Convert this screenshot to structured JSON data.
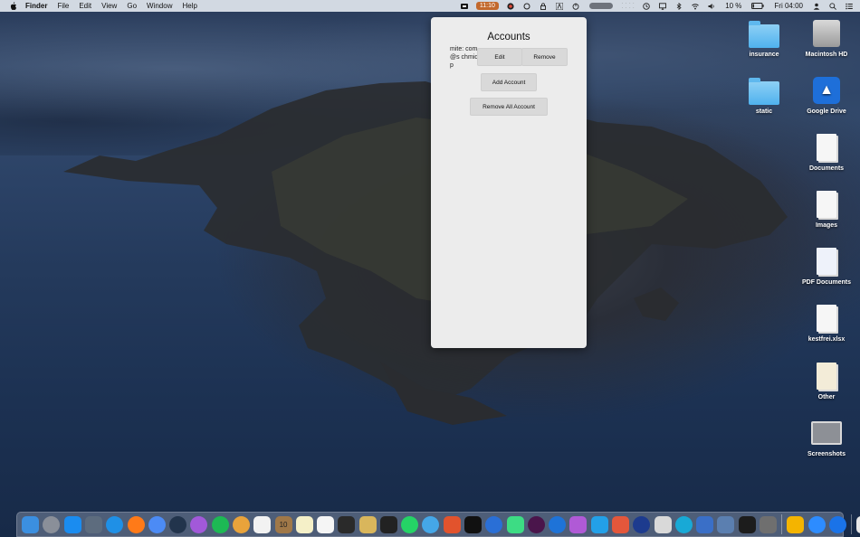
{
  "menubar": {
    "app_name": "Finder",
    "menus": [
      "File",
      "Edit",
      "View",
      "Go",
      "Window",
      "Help"
    ],
    "timer": "11:10",
    "battery": "10 %",
    "clock": "Fri 04:00"
  },
  "accounts_panel": {
    "title": "Accounts",
    "account_name": "mite: com@s chmidp",
    "edit_label": "Edit",
    "remove_label": "Remove",
    "add_label": "Add Account",
    "remove_all_label": "Remove All Account"
  },
  "desktop": {
    "icons": [
      {
        "label": "insurance",
        "icon": "folder-icon"
      },
      {
        "label": "Macintosh HD",
        "icon": "hard-drive-icon"
      },
      {
        "label": "static",
        "icon": "folder-icon"
      },
      {
        "label": "Google Drive",
        "icon": "google-drive-icon"
      },
      {
        "label": "Documents",
        "icon": "document-stack-icon"
      },
      {
        "label": "Images",
        "icon": "document-stack-icon"
      },
      {
        "label": "PDF Documents",
        "icon": "pdf-stack-icon"
      },
      {
        "label": "kestfrei.xlsx",
        "icon": "spreadsheet-file-icon"
      },
      {
        "label": "Other",
        "icon": "certificate-file-icon"
      },
      {
        "label": "Screenshots",
        "icon": "screenshot-folder-icon"
      }
    ]
  },
  "dock": {
    "calendar_day": "10",
    "colors": [
      "#3b8fe0",
      "#8a8f99",
      "#1a8cf0",
      "#5d6c7e",
      "#1f90e6",
      "#ff7a18",
      "#4c8bf5",
      "#22344c",
      "#a259d9",
      "#1db954",
      "#e9a33b",
      "#f2f2f2",
      "#a07848",
      "#f5f0c8",
      "#f5f5f5",
      "#2a2a2a",
      "#d9b65c",
      "#222222",
      "#25d366",
      "#45a7e8",
      "#e2532d",
      "#111111",
      "#2a6fd6",
      "#3ddc84",
      "#4a154b",
      "#1e73d8",
      "#b05ad6",
      "#23a0e8",
      "#e4573b",
      "#1d3b8e",
      "#d9d9d9",
      "#18a9d6",
      "#3a6fc7",
      "#5b7fb0",
      "#1c1c1c",
      "#6f6f6f",
      "#f4b400",
      "#2d8cff",
      "#1a73e8",
      "#e8e8e8",
      "#b8b8b8"
    ]
  }
}
